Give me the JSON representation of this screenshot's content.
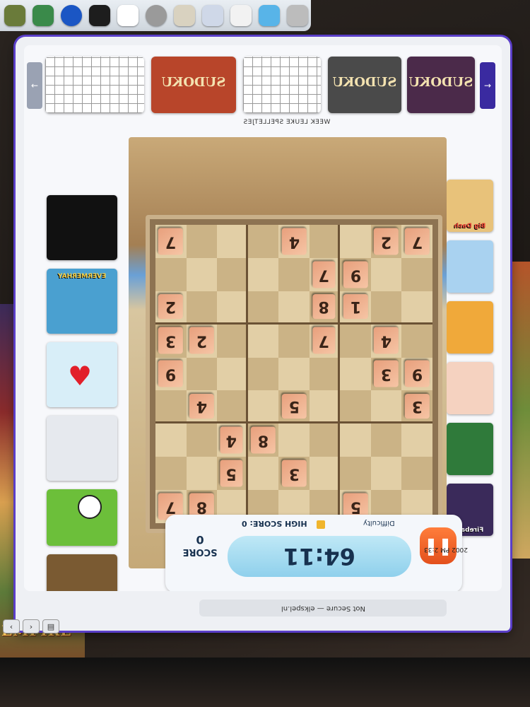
{
  "browser": {
    "url_text": "Not Secure — elkspel.nl",
    "sys_tray": "2002 PM 2:33"
  },
  "top_strip": {
    "week_label": "WEEK LEUKE SPELLETJES",
    "thumbs": [
      "",
      "SUDOKU",
      "",
      "SUDOKU",
      "SUDOKU"
    ]
  },
  "left_games": [
    "",
    "EVERMERHAY",
    "",
    "",
    "",
    "",
    ""
  ],
  "right_games": [
    "Big Dash",
    "",
    "",
    "",
    "",
    "Fireball"
  ],
  "board": {
    "rows": [
      [
        "7",
        "",
        "",
        "",
        "4",
        "",
        "",
        "2",
        "7"
      ],
      [
        "",
        "",
        "",
        "",
        "",
        "7",
        "9",
        "",
        ""
      ],
      [
        "2",
        "",
        "",
        "",
        "",
        "8",
        "1",
        "",
        ""
      ],
      [
        "3",
        "2",
        "",
        "",
        "",
        "7",
        "",
        "4",
        ""
      ],
      [
        "9",
        "",
        "",
        "",
        "",
        "",
        "",
        "3",
        "9"
      ],
      [
        "",
        "4",
        "",
        "",
        "5",
        "",
        "",
        "",
        "3"
      ],
      [
        "",
        "",
        "4",
        "8",
        "",
        "",
        "",
        "",
        ""
      ],
      [
        "",
        "",
        "5",
        "",
        "3",
        "",
        "",
        "",
        ""
      ],
      [
        "7",
        "8",
        "",
        "",
        "",
        "",
        "5",
        "",
        ""
      ]
    ]
  },
  "score": {
    "label": "SCORE",
    "value": "0",
    "high_score": "HIGH SCORE: 0",
    "timer": "64:11",
    "difficulty": "Difficulty"
  },
  "desktop": {
    "empire_text": "EMPIRE"
  },
  "colors": {
    "frame": "#5a3ec8",
    "pause": "#e3501c",
    "tile": "#f6c5a5"
  }
}
